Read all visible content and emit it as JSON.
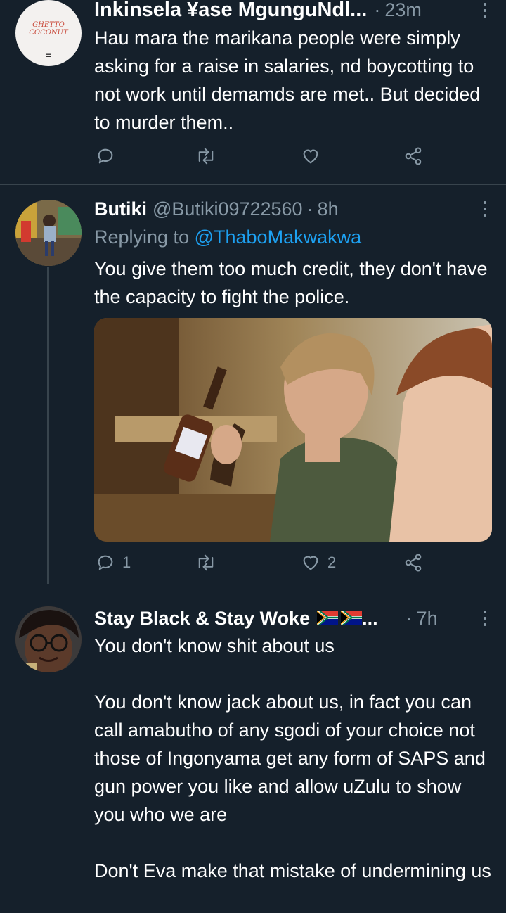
{
  "tweets": [
    {
      "display_name": "Inkinsela ¥ase MgunguNdl...",
      "time": "23m",
      "text": "Hau mara the marikana people were simply asking for a raise in salaries, nd boycotting to not work until demamds are met.. But decided to murder them..",
      "avatar_label_top": "GHETTO",
      "avatar_label_bottom": "COCONUT",
      "avatar_mark": "="
    },
    {
      "display_name": "Butiki",
      "handle": "@Butiki09722560",
      "time": "8h",
      "replying_prefix": "Replying to",
      "replying_to": "@ThaboMakwakwa",
      "text": "You give them too much credit, they don't have the capacity to fight the police.",
      "reply_count": "1",
      "like_count": "2"
    },
    {
      "display_name": "Stay Black & Stay Woke",
      "ellipsis": "...",
      "time": "7h",
      "text": "You don't know shit about us\n\nYou don't know jack about us, in fact you can call amabutho of any sgodi of your choice not those of Ingonyama get any form of SAPS and gun power you like and allow uZulu to show you who we are\n\nDon't Eva make that mistake of undermining us"
    }
  ],
  "colors": {
    "background": "#15202b",
    "secondary_text": "#8899a6",
    "link": "#1da1f2",
    "divider": "#38444d"
  },
  "icons": [
    "reply-icon",
    "retweet-icon",
    "like-icon",
    "share-icon",
    "more-icon",
    "south-africa-flag-icon"
  ]
}
